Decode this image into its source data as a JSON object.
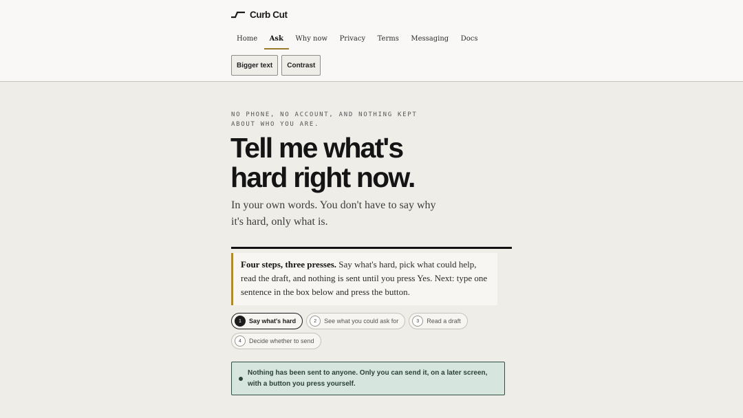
{
  "header": {
    "brand": "Curb Cut",
    "nav": [
      {
        "label": "Home",
        "active": false
      },
      {
        "label": "Ask",
        "active": true
      },
      {
        "label": "Why now",
        "active": false
      },
      {
        "label": "Privacy",
        "active": false
      },
      {
        "label": "Terms",
        "active": false
      },
      {
        "label": "Messaging",
        "active": false
      },
      {
        "label": "Docs",
        "active": false
      }
    ],
    "tools": {
      "bigger_text": "Bigger text",
      "contrast": "Contrast"
    }
  },
  "main": {
    "eyebrow": "No phone, no account, and nothing kept about who you are.",
    "title_line1": "Tell me what's",
    "title_line2": "hard right now.",
    "lede": "In your own words. You don't have to say why it's hard, only what is.",
    "callout_lead": "Four steps, three presses.",
    "callout_body": " Say what's hard, pick what could help, read the draft, and nothing is sent until you press Yes. Next: type one sentence in the box below and press the button.",
    "steps": [
      {
        "num": "1",
        "label": "Say what's hard",
        "current": true
      },
      {
        "num": "2",
        "label": "See what you could ask for",
        "current": false
      },
      {
        "num": "3",
        "label": "Read a draft",
        "current": false
      },
      {
        "num": "4",
        "label": "Decide whether to send",
        "current": false
      }
    ],
    "notice": "Nothing has been sent to anyone. Only you can send it, on a later screen, with a button you press yourself."
  },
  "colors": {
    "accent": "#b0892d",
    "notice_bg": "#d6e5dd",
    "notice_border": "#2f4e43",
    "page_bg": "#efede8"
  }
}
